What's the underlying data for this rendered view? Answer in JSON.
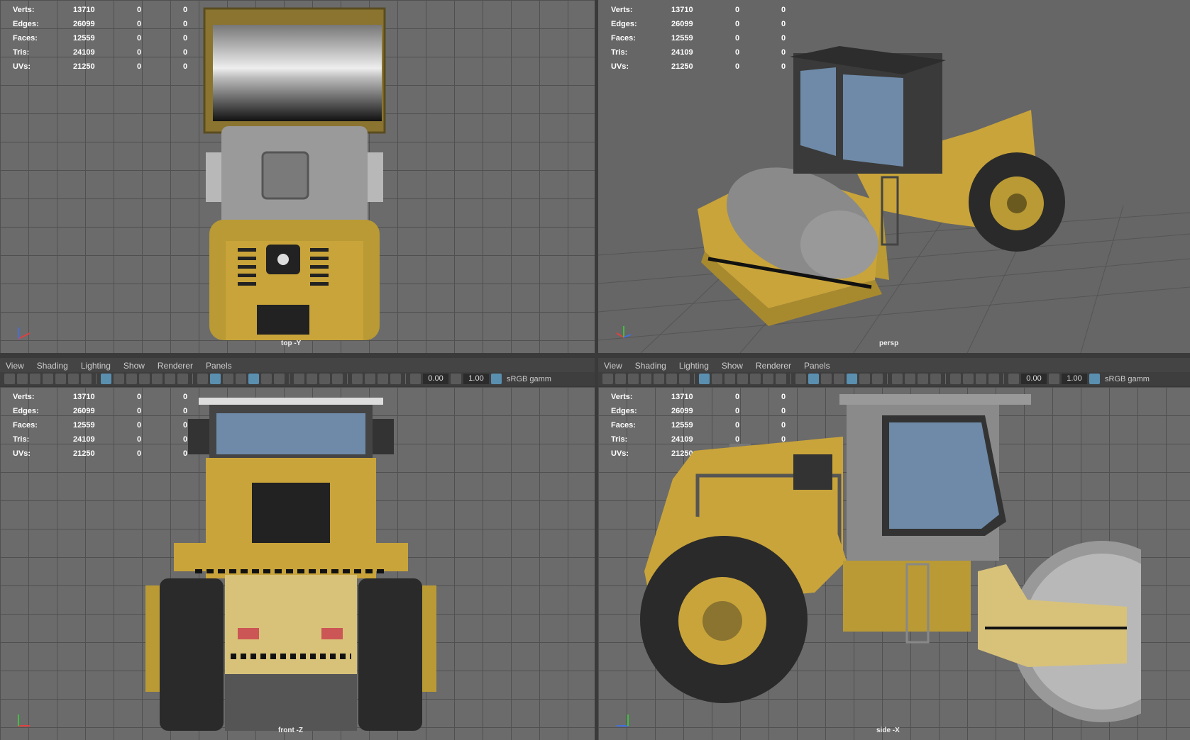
{
  "stats": {
    "rows": [
      {
        "label": "Verts:",
        "v1": "13710",
        "v2": "0",
        "v3": "0"
      },
      {
        "label": "Edges:",
        "v1": "26099",
        "v2": "0",
        "v3": "0"
      },
      {
        "label": "Faces:",
        "v1": "12559",
        "v2": "0",
        "v3": "0"
      },
      {
        "label": "Tris:",
        "v1": "24109",
        "v2": "0",
        "v3": "0"
      },
      {
        "label": "UVs:",
        "v1": "21250",
        "v2": "0",
        "v3": "0"
      }
    ]
  },
  "viewports": {
    "top": {
      "camera": "top -Y"
    },
    "persp": {
      "camera": "persp"
    },
    "front": {
      "camera": "front -Z"
    },
    "side": {
      "camera": "side -X"
    }
  },
  "menu": {
    "items": [
      "View",
      "Shading",
      "Lighting",
      "Show",
      "Renderer",
      "Panels"
    ]
  },
  "toolbar": {
    "field1": "0.00",
    "field2": "1.00",
    "colorspace": "sRGB gamm"
  },
  "colors": {
    "viewport_bg": "#6b6b6b",
    "grid": "#505050",
    "roller_yellow": "#c9a43a",
    "cab_glass": "#6e8aa8",
    "axis_x": "#e04040",
    "axis_y": "#40c040",
    "axis_z": "#4070e0"
  }
}
